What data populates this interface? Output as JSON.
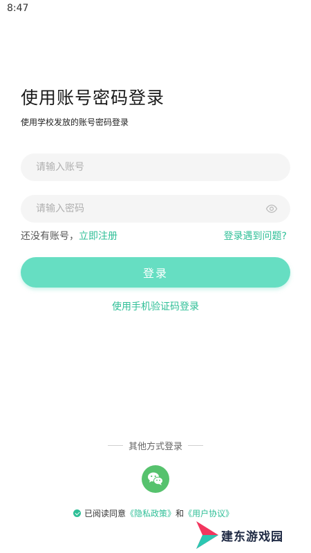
{
  "status_bar": {
    "time": "8:47"
  },
  "header": {
    "title": "使用账号密码登录",
    "subtitle": "使用学校发放的账号密码登录"
  },
  "form": {
    "account_placeholder": "请输入账号",
    "account_value": "",
    "password_placeholder": "请输入密码",
    "password_value": "",
    "no_account_text": "还没有账号，",
    "register_link": "立即注册",
    "problem_link": "登录遇到问题?",
    "login_button": "登录",
    "sms_login_link": "使用手机验证码登录"
  },
  "other_login": {
    "label": "其他方式登录",
    "icon": "wechat-icon"
  },
  "agreement": {
    "prefix": "已阅读同意",
    "privacy_link": "《隐私政策》",
    "and": "和",
    "user_link": "《用户协议》"
  },
  "watermark": {
    "text": "建东游戏园"
  },
  "colors": {
    "accent": "#2fbf97",
    "button": "#66dec2",
    "wechat": "#56c26d",
    "input_bg": "#f5f5f5"
  }
}
